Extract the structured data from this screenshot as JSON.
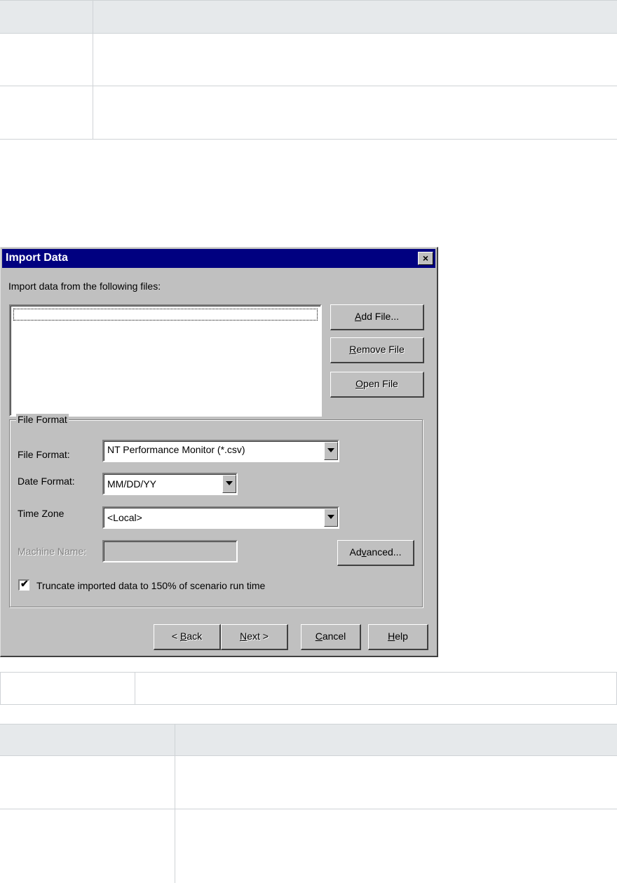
{
  "dialog": {
    "title": "Import Data",
    "close_glyph": "×",
    "import_label": "Import data from the following files:",
    "buttons": {
      "add_file": {
        "mnemonic": "A",
        "rest": "dd File..."
      },
      "remove_file": {
        "mnemonic": "R",
        "rest": "emove File"
      },
      "open_file": {
        "mnemonic": "O",
        "rest": "pen File"
      },
      "advanced": {
        "pre": "Ad",
        "mnemonic": "v",
        "rest": "anced..."
      },
      "back": {
        "pre": "< ",
        "mnemonic": "B",
        "rest": "ack"
      },
      "next": {
        "mnemonic": "N",
        "rest": "ext >"
      },
      "cancel": {
        "mnemonic": "C",
        "rest": "ancel"
      },
      "help": {
        "mnemonic": "H",
        "rest": "elp"
      }
    },
    "file_format_group": {
      "label": "File Format",
      "file_format_label": "File Format:",
      "file_format_value": "NT Performance Monitor (*.csv)",
      "date_format_label": "Date Format:",
      "date_format_value": "MM/DD/YY",
      "time_zone_label": "Time Zone",
      "time_zone_value": "<Local>",
      "machine_name_label": "Machine Name:",
      "machine_name_value": "",
      "truncate_label": "Truncate imported data to 150% of scenario run time",
      "truncate_checked": "✔"
    }
  }
}
